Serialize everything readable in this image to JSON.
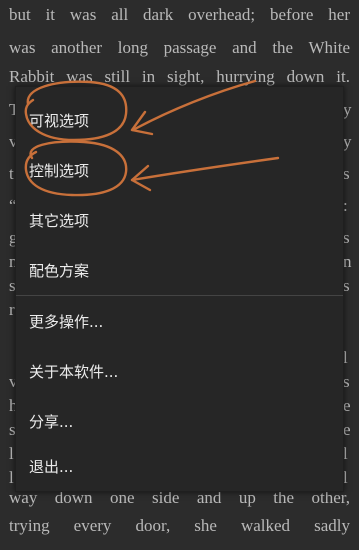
{
  "reader": {
    "lines": [
      "but it was all dark overhead; before her",
      "was another long passage and the White",
      "Rabbit was still in sight, hurrying down it.",
      "T",
      "v",
      "t",
      "“",
      "g",
      "n",
      "s",
      "r",
      "",
      "l",
      "v",
      "h",
      "s",
      "l",
      "l",
      "way down one side and up the other,",
      "trying every door, she walked sadly"
    ],
    "right_edge": [
      "y",
      "y",
      "s",
      ":",
      "s",
      "n",
      "s",
      "",
      "",
      "l",
      "s",
      "e",
      "e",
      "l",
      "l"
    ]
  },
  "menu": {
    "items": [
      {
        "label": "可视选项"
      },
      {
        "label": "控制选项"
      },
      {
        "label": "其它选项"
      },
      {
        "label": "配色方案"
      },
      {
        "label": "更多操作..."
      },
      {
        "label": "关于本软件..."
      },
      {
        "label": "分享..."
      },
      {
        "label": "退出..."
      }
    ]
  },
  "colors": {
    "background": "#2c2c2c",
    "menu_background": "#262626",
    "text": "#b9b9b9",
    "menu_text": "#ececec",
    "annotation": "#c8703a"
  }
}
